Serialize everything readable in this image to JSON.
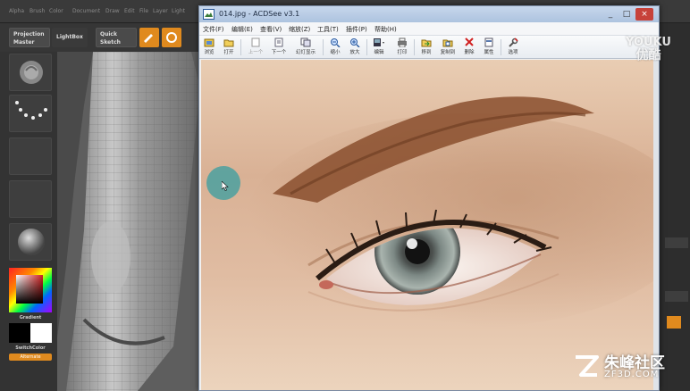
{
  "zbrush": {
    "menu": [
      "Alpha",
      "Brush",
      "Color",
      "Document",
      "Draw",
      "Edit",
      "File",
      "Layer",
      "Light"
    ],
    "toolbar": {
      "projection_master": "Projection Master",
      "lightbox": "LightBox",
      "quick_sketch": "Quick Sketch",
      "edit_label": "Edit",
      "draw_label": "Draw"
    },
    "tray": {
      "gradient_label": "Gradient",
      "switchcolor_label": "SwitchColor",
      "alternate_label": "Alternate"
    }
  },
  "acdsee": {
    "title": "014.jpg - ACDSee v3.1",
    "window_controls": {
      "minimize": "_",
      "maximize": "□",
      "close": "×"
    },
    "menu": [
      "文件(F)",
      "编辑(E)",
      "查看(V)",
      "缩放(Z)",
      "工具(T)",
      "插件(P)",
      "帮助(H)"
    ],
    "toolbar": [
      {
        "label": "浏览",
        "icon": "browse-icon"
      },
      {
        "label": "打开",
        "icon": "open-icon"
      },
      {
        "label": "上一个",
        "icon": "previous-icon"
      },
      {
        "label": "下一个",
        "icon": "next-icon"
      },
      {
        "label": "幻灯显示",
        "icon": "slideshow-icon"
      },
      {
        "label": "缩小",
        "icon": "zoom-out-icon"
      },
      {
        "label": "放大",
        "icon": "zoom-in-icon"
      },
      {
        "label": "编辑",
        "icon": "edit-icon"
      },
      {
        "label": "打印",
        "icon": "print-icon"
      },
      {
        "label": "移到",
        "icon": "move-to-icon"
      },
      {
        "label": "复制到",
        "icon": "copy-to-icon"
      },
      {
        "label": "删除",
        "icon": "delete-icon"
      },
      {
        "label": "属性",
        "icon": "properties-icon"
      },
      {
        "label": "选项",
        "icon": "options-icon"
      }
    ]
  },
  "watermarks": {
    "youku_en": "YOUKU",
    "youku_cn": "优酷",
    "zf3d_name": "朱峰社区",
    "zf3d_domain": "ZF3D.COM"
  },
  "colors": {
    "zbrush_orange": "#e08a1e",
    "cursor_highlight": "#46a0a0",
    "titlebar": "#b7cbe5"
  }
}
